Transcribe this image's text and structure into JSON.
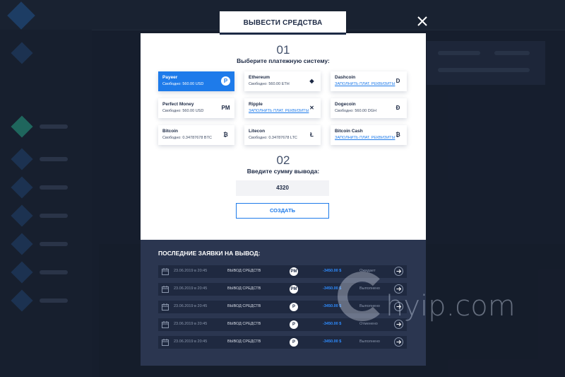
{
  "modal": {
    "tab_label": "ВЫВЕСТИ СРЕДСТВА",
    "step1_num": "01",
    "step1_title": "Выберите платежную систему:",
    "step2_num": "02",
    "step2_title": "Введите сумму вывода:",
    "amount_value": "4320",
    "create_label": "СОЗДАТЬ",
    "payment_systems": [
      {
        "name": "Payeer",
        "balance": "Свободно: 560.00 USD",
        "icon": "P",
        "selected": true
      },
      {
        "name": "Ethereum",
        "balance": "Свободно: 560.00 ETH",
        "icon": "◆"
      },
      {
        "name": "Dashcoin",
        "link": "ЗАПОЛНИТЬ ПЛАТ. РЕКВИЗИТЫ",
        "icon": "D"
      },
      {
        "name": "Perfect Money",
        "balance": "Свободно: 560.00 USD",
        "icon": "PM"
      },
      {
        "name": "Ripple",
        "link": "ЗАПОЛНИТЬ ПЛАТ. РЕКВИЗИТЫ",
        "icon": "✕"
      },
      {
        "name": "Dogecoin",
        "balance": "Свободно: 560.00 DGH",
        "icon": "Ð"
      },
      {
        "name": "Bitcoin",
        "balance": "Свободно: 0.34787678 BTC",
        "icon": "₿"
      },
      {
        "name": "Litecon",
        "balance": "Свободно: 0.34787678 LTC",
        "icon": "Ł"
      },
      {
        "name": "Bitcoin Cash",
        "link": "ЗАПОЛНИТЬ ПЛАТ. РЕКВИЗИТЫ",
        "icon": "₿"
      }
    ]
  },
  "requests": {
    "title": "ПОСЛЕДНИЕ ЗАЯВКИ НА ВЫВОД:",
    "rows": [
      {
        "date": "23.06.2019 в 20:45",
        "label": "ВЫВОД СРЕДСТВ",
        "icon": "PM",
        "amount": "-3450.00 $",
        "status": "Ожидает"
      },
      {
        "date": "23.06.2019 в 20:45",
        "label": "ВЫВОД СРЕДСТВ",
        "icon": "PM",
        "amount": "-3450.00 $",
        "status": "Выполнено"
      },
      {
        "date": "23.06.2019 в 20:45",
        "label": "ВЫВОД СРЕДСТВ",
        "icon": "P",
        "amount": "-3450.00 $",
        "status": "Выполнено"
      },
      {
        "date": "23.06.2019 в 20:45",
        "label": "ВЫВОД СРЕДСТВ",
        "icon": "P",
        "amount": "-3450.00 $",
        "status": "Отменено"
      },
      {
        "date": "23.06.2019 в 20:45",
        "label": "ВЫВОД СРЕДСТВ",
        "icon": "P",
        "amount": "-3450.00 $",
        "status": "Выполнено"
      }
    ]
  },
  "watermark": {
    "text": "hyip.com"
  },
  "colors": {
    "accent": "#1e7bea",
    "panel": "#2b3650",
    "background": "#1b2436"
  },
  "icons": {
    "close": "close-icon",
    "calendar": "calendar-icon",
    "arrow": "arrow-right-icon"
  }
}
